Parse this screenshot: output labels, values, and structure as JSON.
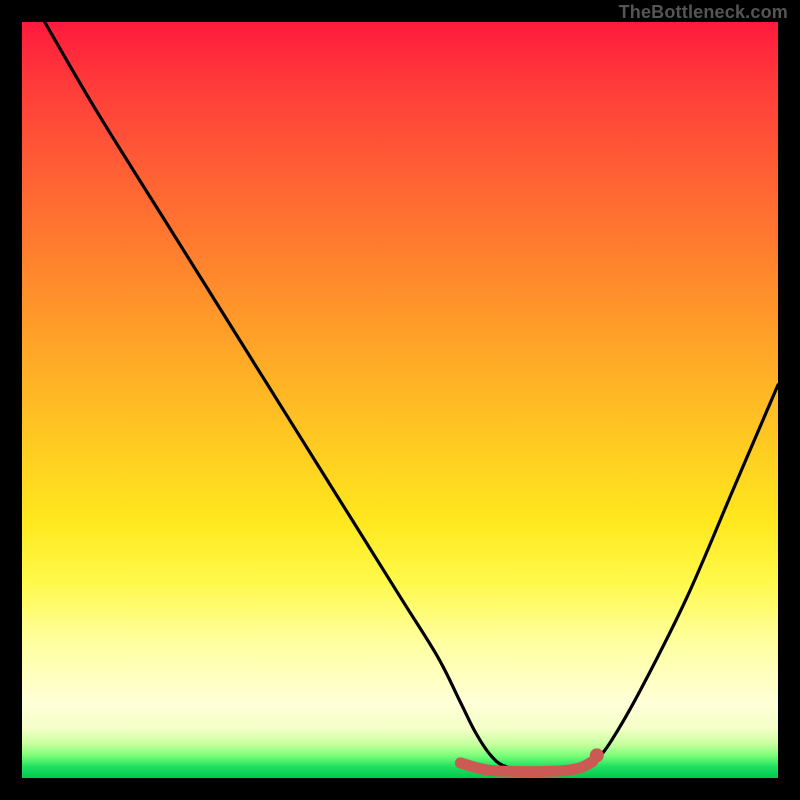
{
  "watermark": "TheBottleneck.com",
  "chart_data": {
    "type": "line",
    "title": "",
    "xlabel": "",
    "ylabel": "",
    "xlim": [
      0,
      100
    ],
    "ylim": [
      0,
      100
    ],
    "grid": false,
    "legend": false,
    "series": [
      {
        "name": "bottleneck-curve",
        "color": "#000000",
        "x": [
          3,
          10,
          20,
          30,
          40,
          50,
          55,
          58,
          60,
          62,
          64,
          68,
          72,
          74,
          76,
          78,
          82,
          88,
          94,
          100
        ],
        "y": [
          100,
          88,
          72,
          56,
          40,
          24,
          16,
          10,
          6,
          3,
          1.5,
          0.8,
          0.8,
          1.2,
          2.5,
          5,
          12,
          24,
          38,
          52
        ]
      }
    ],
    "annotations": [
      {
        "name": "flat-bottom-band",
        "type": "points",
        "color": "#cc5a54",
        "x": [
          58,
          60,
          62,
          64,
          66,
          68,
          70,
          72,
          74,
          75.5
        ],
        "y": [
          2.0,
          1.4,
          1.0,
          0.9,
          0.85,
          0.85,
          0.9,
          1.0,
          1.4,
          2.2
        ]
      }
    ]
  }
}
